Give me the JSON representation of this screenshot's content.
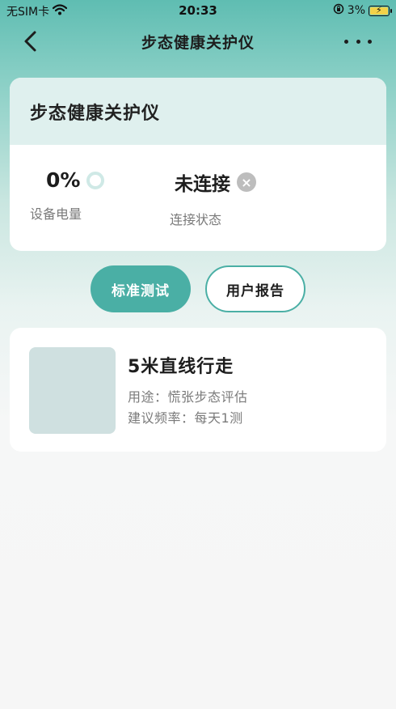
{
  "status_bar": {
    "carrier": "无SIM卡",
    "time": "20:33",
    "battery_percent": "3%",
    "icons": [
      "wifi-icon",
      "orientation-lock-icon",
      "battery-charging-icon"
    ]
  },
  "nav": {
    "title": "步态健康关护仪",
    "back_icon": "chevron-left-icon",
    "more_icon": "more-dots-icon"
  },
  "device_card": {
    "title": "步态健康关护仪",
    "battery": {
      "value": "0%",
      "label": "设备电量",
      "icon": "ring-icon"
    },
    "connection": {
      "value": "未连接",
      "label": "连接状态",
      "icon": "close-circle-icon"
    }
  },
  "tabs": {
    "standard_label": "标准测试",
    "report_label": "用户报告",
    "active": "standard"
  },
  "tests": [
    {
      "title": "5米直线行走",
      "usage": "用途：慌张步态评估",
      "frequency": "建议频率：每天1测"
    }
  ],
  "colors": {
    "accent": "#4aafa5",
    "header_top": "#5fbdb2",
    "card_head": "#dff0ee",
    "thumb": "#cfe0e0"
  }
}
